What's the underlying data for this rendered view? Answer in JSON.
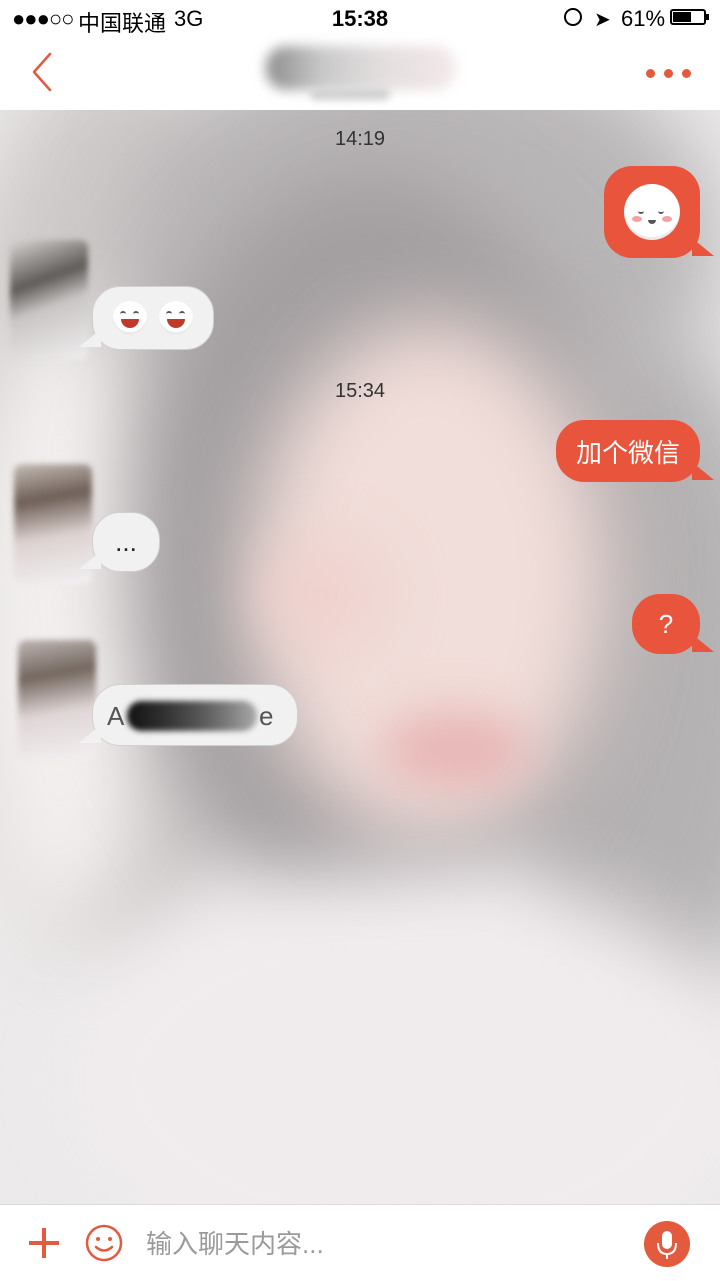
{
  "status_bar": {
    "signal": "●●●○○",
    "carrier": "中国联通",
    "network": "3G",
    "time": "15:38",
    "battery_percent": "61%",
    "battery_level": 0.61
  },
  "nav_bar": {
    "back_icon": "chevron-left-icon",
    "more_icon": "more-dots-icon",
    "accent_color": "#e35a3e"
  },
  "messages": [
    {
      "type": "timestamp",
      "text": "14:19"
    },
    {
      "type": "outgoing",
      "content": "emoji",
      "emoji": "smiling-face-emoji"
    },
    {
      "type": "incoming",
      "content": "emoji",
      "emoji": [
        "laughing-face-emoji",
        "laughing-face-emoji"
      ]
    },
    {
      "type": "timestamp",
      "text": "15:34"
    },
    {
      "type": "outgoing",
      "content": "text",
      "text": "加个微信"
    },
    {
      "type": "incoming",
      "content": "text",
      "text": "..."
    },
    {
      "type": "outgoing",
      "content": "text",
      "text": "?"
    },
    {
      "type": "incoming",
      "content": "text",
      "text_prefix": "A",
      "text_suffix": "e",
      "redacted": true
    }
  ],
  "input_bar": {
    "placeholder": "输入聊天内容...",
    "add_icon": "plus-icon",
    "emoji_icon": "smiley-icon",
    "voice_icon": "microphone-icon"
  },
  "colors": {
    "outgoing_bubble": "#e8553c",
    "incoming_bubble": "#f2f1f1",
    "accent": "#e35a3e"
  }
}
